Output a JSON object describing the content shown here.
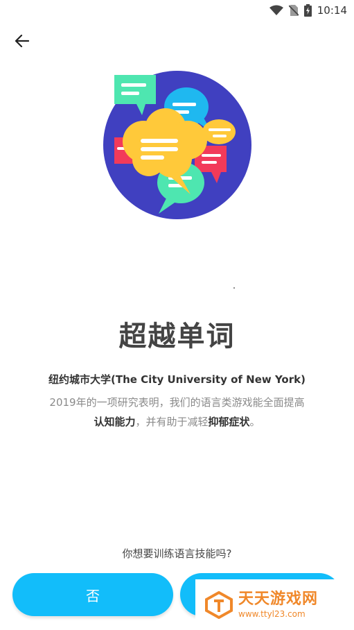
{
  "status": {
    "time": "10:14"
  },
  "hero": {
    "icon": "chat-bubbles-illustration"
  },
  "title": "超越单词",
  "source": "纽约城市大学(The City University of New York)",
  "description": {
    "line1": "2019年的一项研究表明，我们的语言类游戏能全面提高",
    "line2_bold1": "认知能力",
    "line2_mid": "，并有助于减轻",
    "line2_bold2": "抑郁症状",
    "line2_end": "。"
  },
  "question": "你想要训练语言技能吗?",
  "buttons": {
    "no": "否"
  },
  "watermark": {
    "main": "天天游戏网",
    "url": "www.ttyl23.com"
  },
  "colors": {
    "button": "#12bdfa",
    "hero_circle": "#4040c0",
    "watermark": "#f0882a"
  }
}
